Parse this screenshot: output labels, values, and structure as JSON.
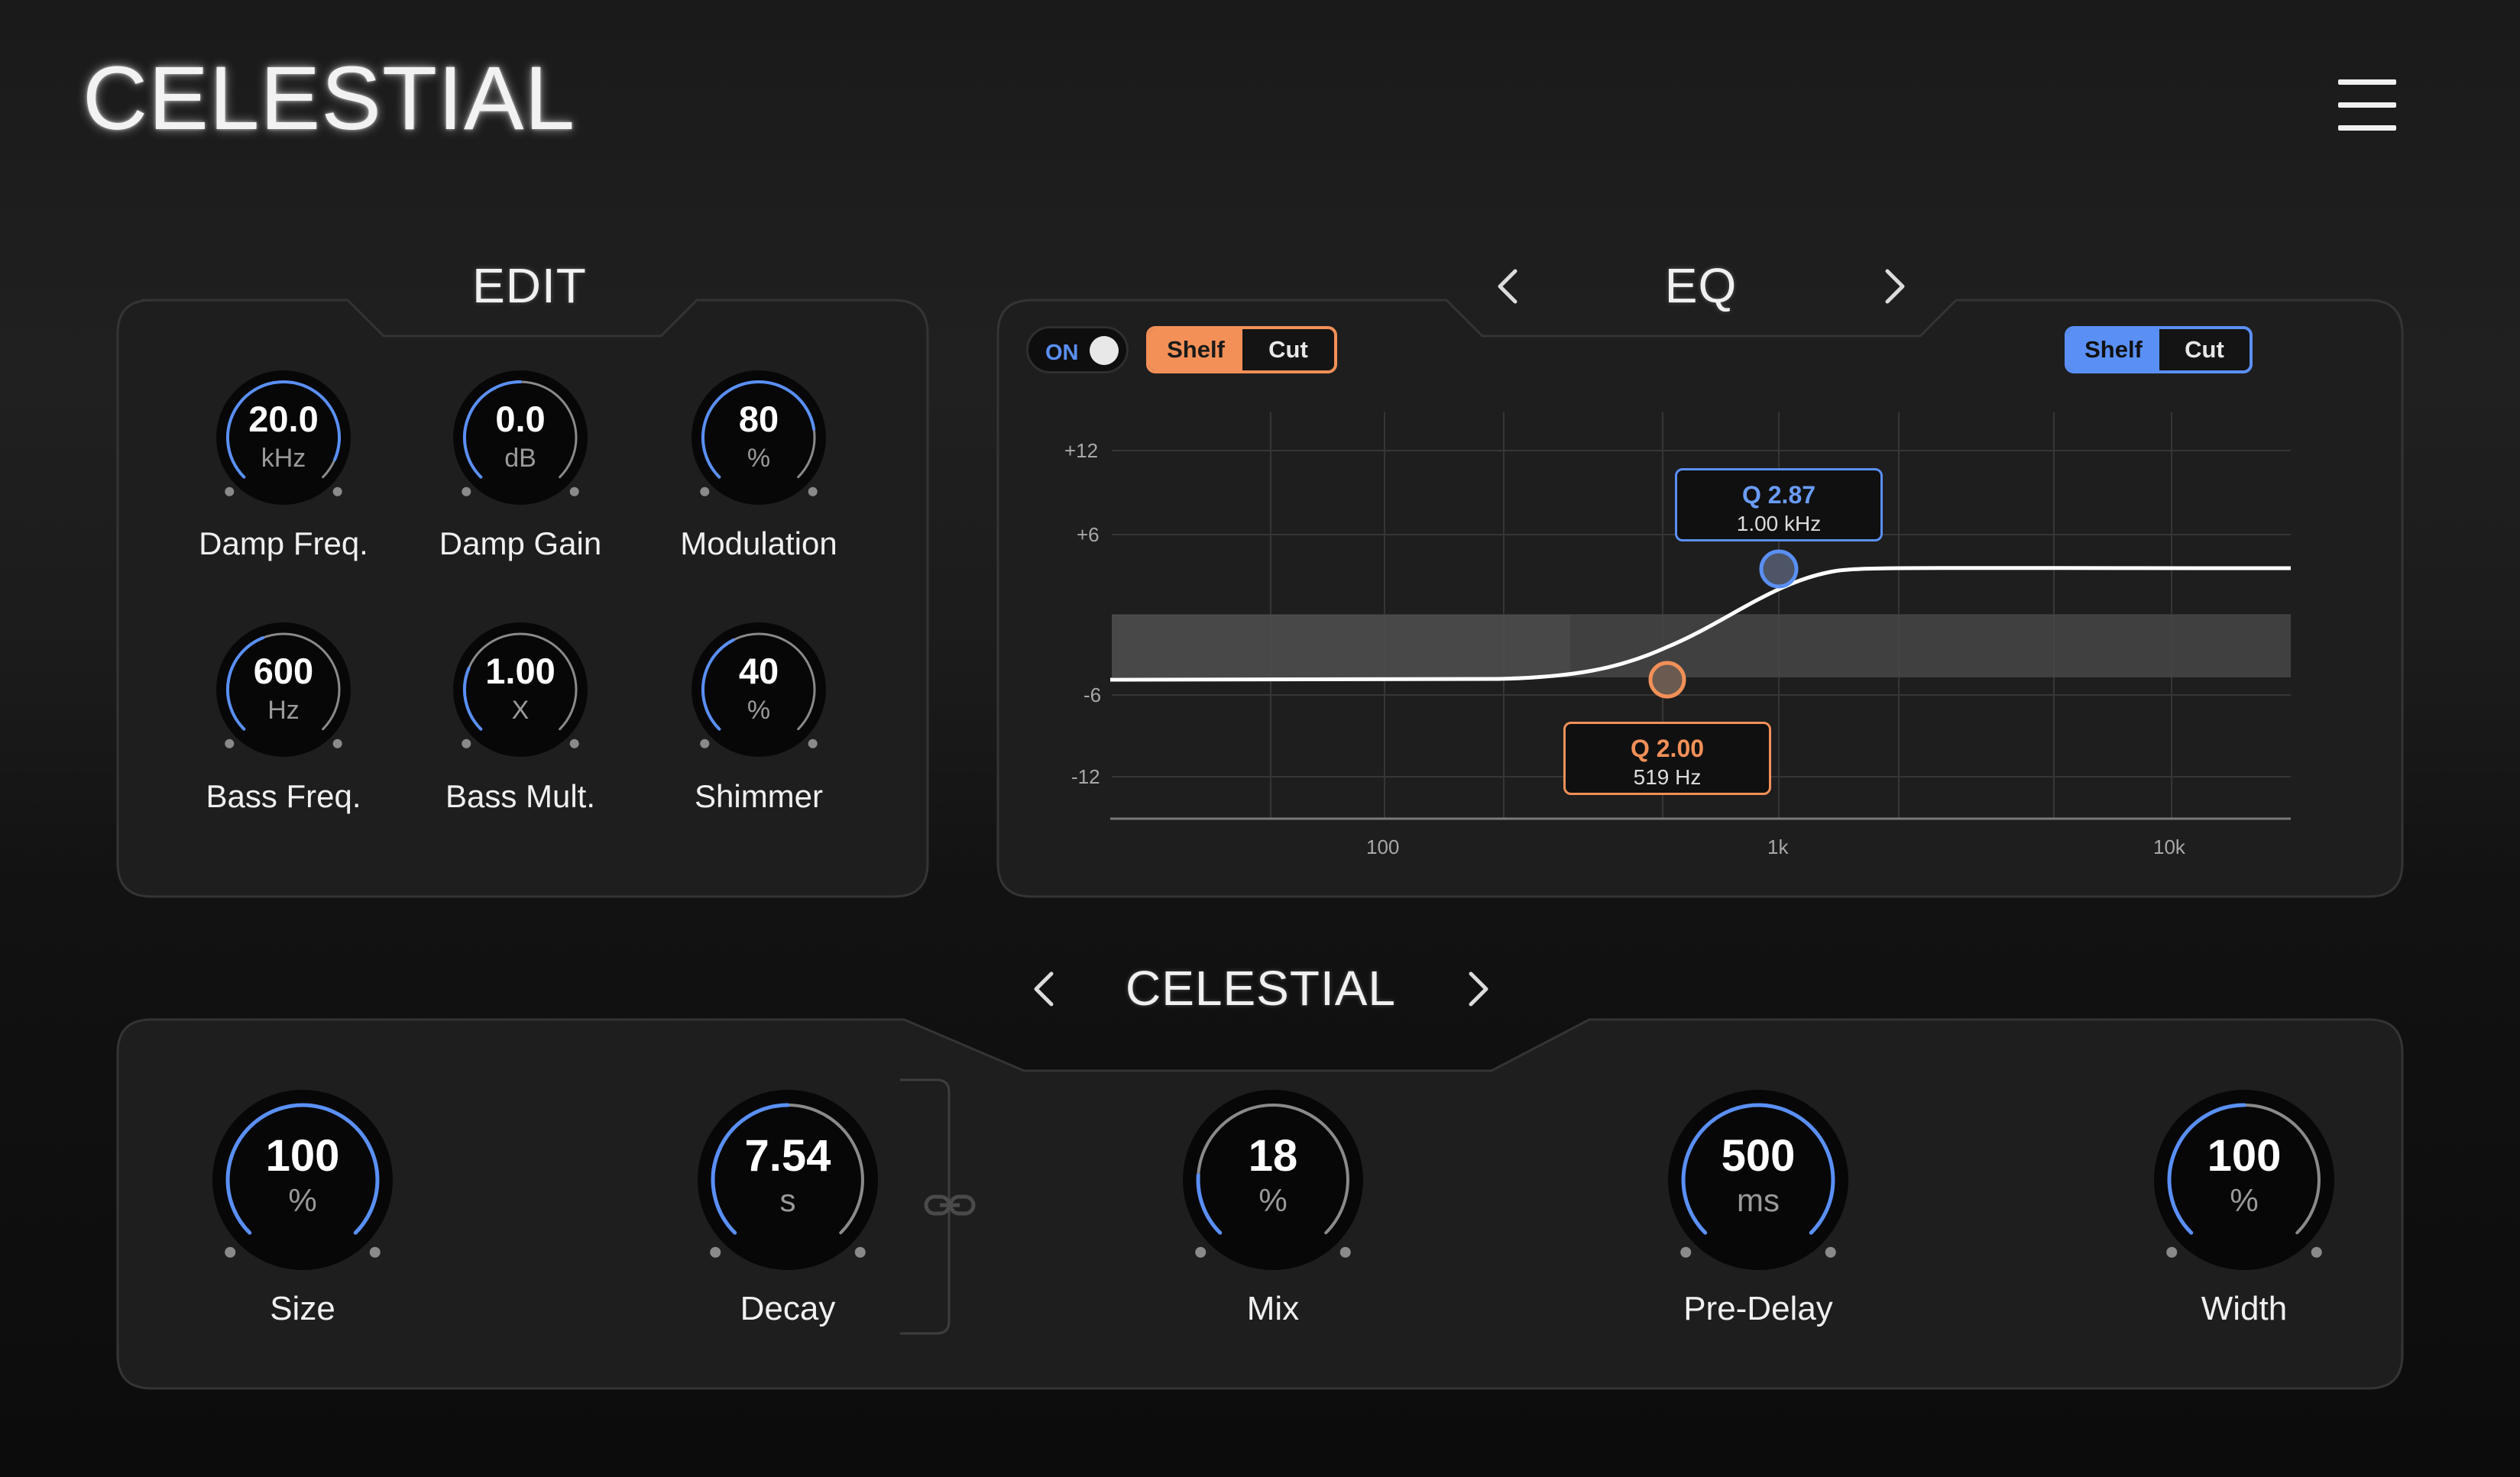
{
  "app": {
    "title": "CELESTIAL",
    "menu_icon": "hamburger-icon"
  },
  "colors": {
    "accent_blue": "#5a90f5",
    "accent_orange": "#f29058",
    "panel_bg": "#1d1d1d",
    "panel_border": "#333333"
  },
  "edit_panel": {
    "title": "EDIT",
    "knobs": [
      {
        "id": "damp-freq",
        "value": "20.0",
        "unit": "kHz",
        "label": "Damp Freq.",
        "level": 0.92
      },
      {
        "id": "damp-gain",
        "value": "0.0",
        "unit": "dB",
        "label": "Damp Gain",
        "level": 0.5
      },
      {
        "id": "modulation",
        "value": "80",
        "unit": "%",
        "label": "Modulation",
        "level": 0.8
      },
      {
        "id": "bass-freq",
        "value": "600",
        "unit": "Hz",
        "label": "Bass Freq.",
        "level": 0.42
      },
      {
        "id": "bass-mult",
        "value": "1.00",
        "unit": "X",
        "label": "Bass Mult.",
        "level": 0.25
      },
      {
        "id": "shimmer",
        "value": "40",
        "unit": "%",
        "label": "Shimmer",
        "level": 0.4
      }
    ]
  },
  "eq_panel": {
    "title": "EQ",
    "toggle_label": "ON",
    "toggle_on": true,
    "low_band": {
      "shelf_label": "Shelf",
      "cut_label": "Cut",
      "selected": "Shelf",
      "q_label": "Q 2.00",
      "freq_label": "519 Hz"
    },
    "high_band": {
      "shelf_label": "Shelf",
      "cut_label": "Cut",
      "selected": "Shelf",
      "q_label": "Q 2.87",
      "freq_label": "1.00 kHz"
    },
    "y_ticks": [
      "+12",
      "+6",
      "-6",
      "-12"
    ],
    "x_ticks": [
      "100",
      "1k",
      "10k"
    ]
  },
  "preset_bar": {
    "name": "CELESTIAL"
  },
  "main_panel": {
    "link_icon": "link-icon",
    "knobs": [
      {
        "id": "size",
        "value": "100",
        "unit": "%",
        "label": "Size",
        "level": 1.0
      },
      {
        "id": "decay",
        "value": "7.54",
        "unit": "s",
        "label": "Decay",
        "level": 0.5
      },
      {
        "id": "mix",
        "value": "18",
        "unit": "%",
        "label": "Mix",
        "level": 0.18
      },
      {
        "id": "pre-delay",
        "value": "500",
        "unit": "ms",
        "label": "Pre-Delay",
        "level": 1.0
      },
      {
        "id": "width",
        "value": "100",
        "unit": "%",
        "label": "Width",
        "level": 0.5
      }
    ]
  }
}
